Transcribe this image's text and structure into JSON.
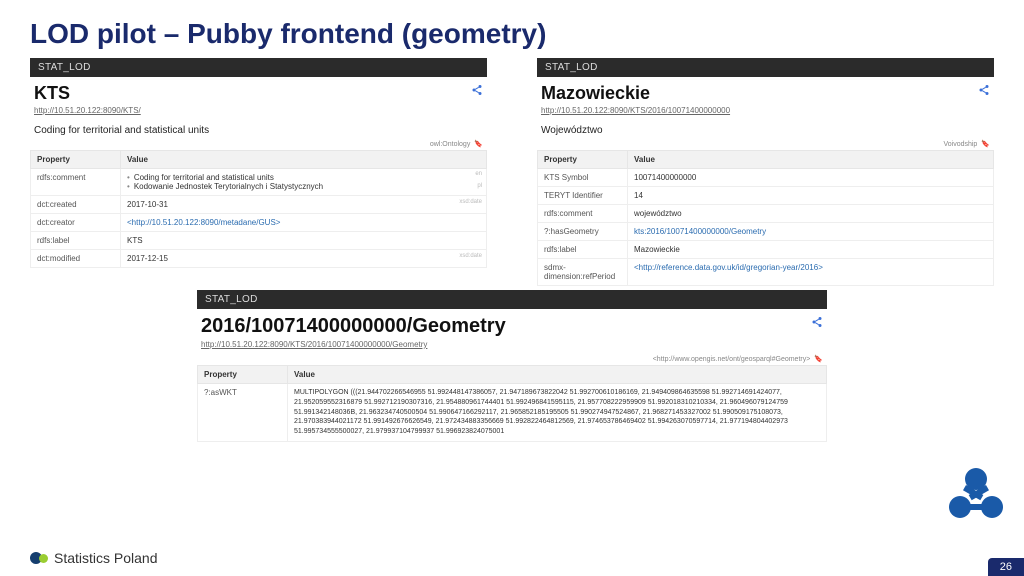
{
  "slide": {
    "title": "LOD pilot – Pubby frontend (geometry)",
    "page_number": "26",
    "footer_brand": "Statistics Poland"
  },
  "panel_left": {
    "bar": "STAT_LOD",
    "title": "KTS",
    "url": "http://10.51.20.122:8090/KTS/",
    "subtitle": "Coding for territorial and statistical units",
    "meta_right": "owl:Ontology",
    "headers": {
      "property": "Property",
      "value": "Value"
    },
    "rows": [
      {
        "k": "rdfs:comment",
        "v_list": [
          "Coding for territorial and statistical units",
          "Kodowanie Jednostek Terytorialnych i Statystycznych"
        ],
        "tags": [
          "en",
          "pl"
        ]
      },
      {
        "k": "dct:created",
        "v": "2017-10-31",
        "tag": "xsd:date"
      },
      {
        "k": "dct:creator",
        "v_link": "<http://10.51.20.122:8090/metadane/GUS>"
      },
      {
        "k": "rdfs:label",
        "v": "KTS"
      },
      {
        "k": "dct:modified",
        "v": "2017-12-15",
        "tag": "xsd:date"
      }
    ]
  },
  "panel_right": {
    "bar": "STAT_LOD",
    "title": "Mazowieckie",
    "url": "http://10.51.20.122:8090/KTS/2016/10071400000000",
    "subtitle": "Województwo",
    "meta_right": "Voivodship",
    "headers": {
      "property": "Property",
      "value": "Value"
    },
    "rows": [
      {
        "k": "KTS Symbol",
        "v": "10071400000000"
      },
      {
        "k": "TERYT Identifier",
        "v": "14"
      },
      {
        "k": "rdfs:comment",
        "v": "województwo"
      },
      {
        "k": "?:hasGeometry",
        "v_link": "kts:2016/10071400000000/Geometry"
      },
      {
        "k": "rdfs:label",
        "v": "Mazowieckie"
      },
      {
        "k": "sdmx-dimension:refPeriod",
        "v_link": "<http://reference.data.gov.uk/id/gregorian-year/2016>"
      }
    ]
  },
  "panel_bottom": {
    "bar": "STAT_LOD",
    "title": "2016/10071400000000/Geometry",
    "url": "http://10.51.20.122:8090/KTS/2016/10071400000000/Geometry",
    "meta_right": "<http://www.opengis.net/ont/geosparql#Geometry>",
    "headers": {
      "property": "Property",
      "value": "Value"
    },
    "wkt_key": "?:asWKT",
    "wkt_value": "MULTIPOLYGON (((21.944702266546955 51.992448147386057, 21.947189673822042 51.992700610186169, 21.949409864635598 51.992714691424077, 21.952059552316879 51.992712190307316, 21.954880961744401 51.992496841595115, 21.957708222959909 51.992018310210334, 21.960496079124759 51.991342148036B, 21.963234740500504 51.990647166292117, 21.965852185195505 51.990274947524867, 21.968271453327002 51.990509175108073, 21.970383944021172 51.991492676626549, 21.972434883356669 51.992822464812569, 21.974653786469402 51.994263070597714, 21.977194804402973 51.995734555500027, 21.979937104799937 51.996923824075001"
  }
}
